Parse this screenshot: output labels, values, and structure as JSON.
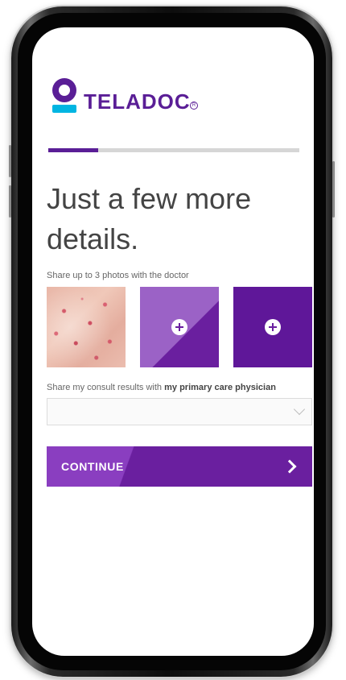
{
  "brand": {
    "name": "TELADOC",
    "mark_color": "#5a1e96",
    "accent_color": "#00b5e2"
  },
  "progress": {
    "fraction": 0.2
  },
  "heading": "Just a few more details.",
  "photos": {
    "label": "Share up to 3 photos with the doctor",
    "slots": [
      {
        "kind": "image",
        "description": "skin-rash-photo"
      },
      {
        "kind": "add",
        "icon": "plus-circle-icon"
      },
      {
        "kind": "add",
        "icon": "plus-circle-icon"
      }
    ]
  },
  "share": {
    "label_prefix": "Share my consult results with ",
    "label_bold": "my primary care physician",
    "select_value": ""
  },
  "continue_button": {
    "label": "CONTINUE",
    "icon": "chevron-right-icon"
  }
}
